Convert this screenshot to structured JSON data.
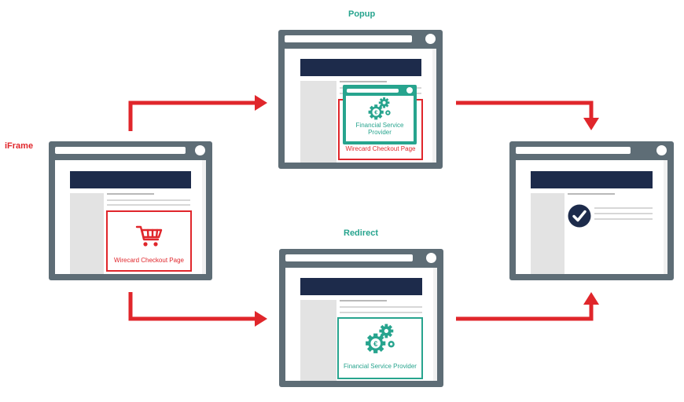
{
  "labels": {
    "iframe": "iFrame",
    "popup": "Popup",
    "redirect": "Redirect"
  },
  "iframe_window": {
    "checkout_label": "Wirecard Checkout Page",
    "icon": "shopping-cart-icon"
  },
  "popup_window": {
    "provider_label": "Financial Service Provider",
    "checkout_label": "Wirecard Checkout Page",
    "icon": "gears-euro-icon"
  },
  "redirect_window": {
    "provider_label": "Financial Service Provider",
    "icon": "gears-euro-icon"
  },
  "result_window": {
    "icon": "checkmark-circle-icon"
  },
  "colors": {
    "red": "#e0262b",
    "teal": "#27a48e",
    "navy": "#1d2b4b",
    "frame": "#5e6d76"
  }
}
